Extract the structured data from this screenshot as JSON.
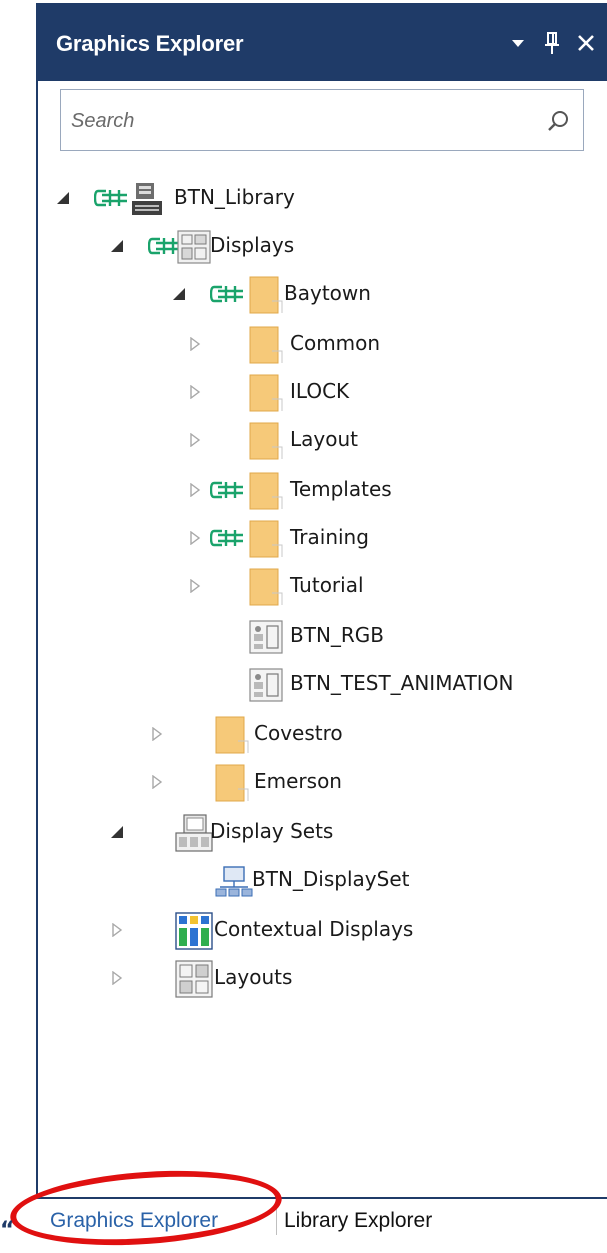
{
  "panel": {
    "title": "Graphics Explorer",
    "buttons": {
      "dropdown": "dropdown-arrow",
      "pin": "pin-icon",
      "close": "close-icon"
    }
  },
  "search": {
    "placeholder": "Search",
    "value": ""
  },
  "tree": [
    {
      "label": "BTN_Library",
      "icon": "library-icon",
      "expanded": true,
      "linked": true
    },
    {
      "label": "Displays",
      "icon": "displays-folder-icon",
      "expanded": true,
      "linked": true
    },
    {
      "label": "Baytown",
      "icon": "folder-icon",
      "expanded": true,
      "linked": true
    },
    {
      "label": "Common",
      "icon": "folder-icon",
      "expanded": false,
      "linked": false
    },
    {
      "label": "ILOCK",
      "icon": "folder-icon",
      "expanded": false,
      "linked": false
    },
    {
      "label": "Layout",
      "icon": "folder-icon",
      "expanded": false,
      "linked": false
    },
    {
      "label": "Templates",
      "icon": "folder-icon",
      "expanded": false,
      "linked": true
    },
    {
      "label": "Training",
      "icon": "folder-icon",
      "expanded": false,
      "linked": true
    },
    {
      "label": "Tutorial",
      "icon": "folder-icon",
      "expanded": false,
      "linked": false
    },
    {
      "label": "BTN_RGB",
      "icon": "display-file-icon"
    },
    {
      "label": "BTN_TEST_ANIMATION",
      "icon": "display-file-icon"
    },
    {
      "label": "Covestro",
      "icon": "folder-icon",
      "expanded": false,
      "linked": false
    },
    {
      "label": "Emerson",
      "icon": "folder-icon",
      "expanded": false,
      "linked": false
    },
    {
      "label": "Display Sets",
      "icon": "display-sets-icon",
      "expanded": true,
      "linked": false
    },
    {
      "label": "BTN_DisplaySet",
      "icon": "display-set-icon"
    },
    {
      "label": "Contextual Displays",
      "icon": "contextual-displays-icon",
      "expanded": false,
      "linked": false
    },
    {
      "label": "Layouts",
      "icon": "layouts-icon",
      "expanded": false,
      "linked": false
    }
  ],
  "tabs": {
    "active": "Graphics Explorer",
    "inactive": "Library Explorer"
  },
  "colors": {
    "titlebar": "#1f3b68",
    "link_icon": "#1aa36b",
    "folder": "#f6c979",
    "active_tab": "#2a62a8",
    "highlight": "#e01010"
  }
}
